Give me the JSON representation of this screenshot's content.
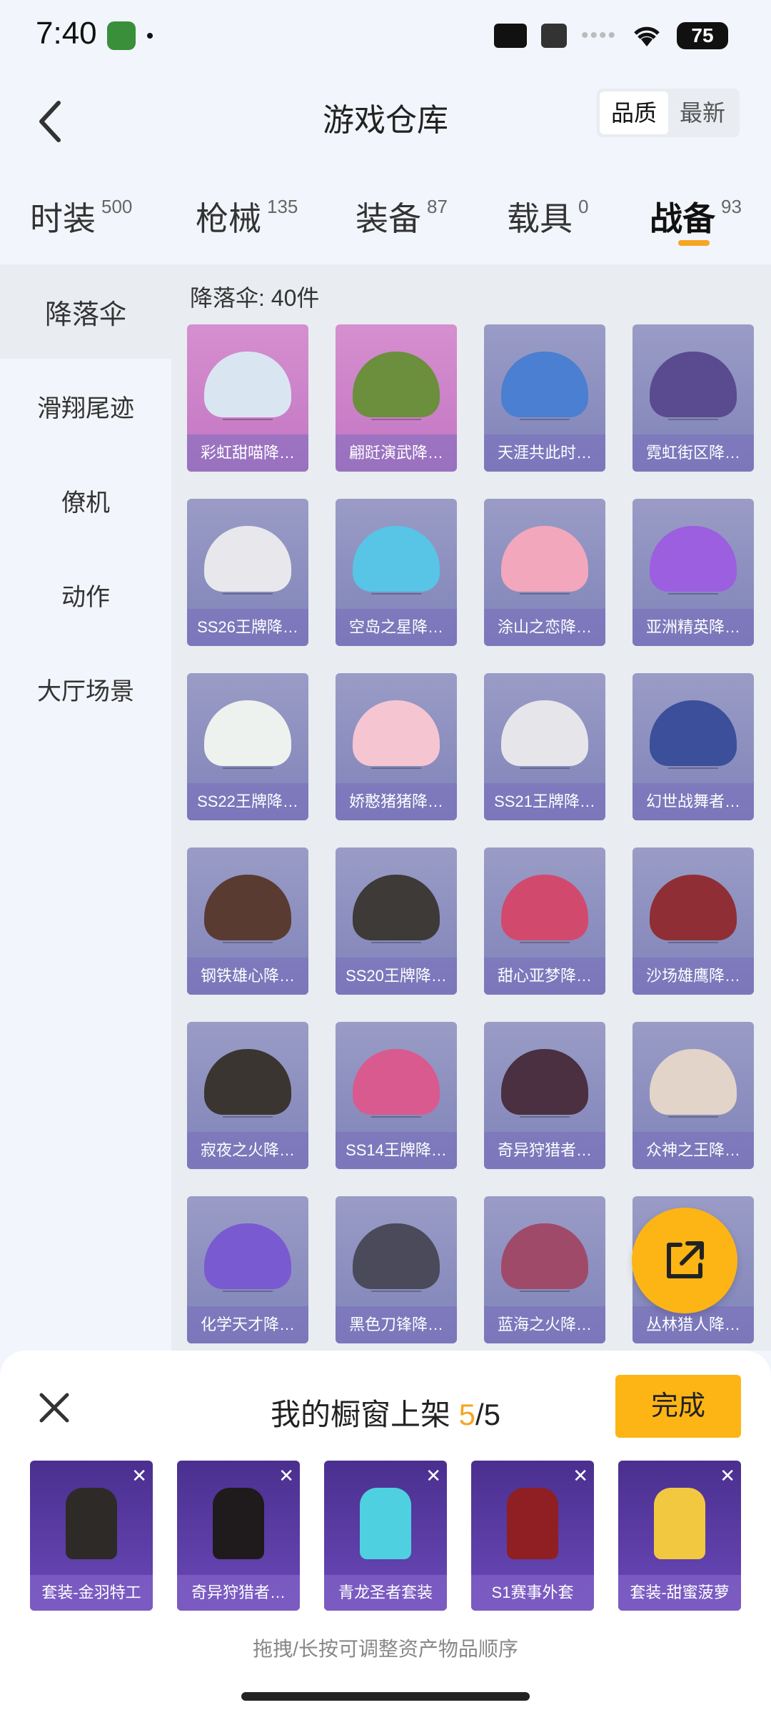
{
  "status_bar": {
    "time": "7:40",
    "battery": "75"
  },
  "header": {
    "title": "游戏仓库",
    "sort_options": [
      "品质",
      "最新"
    ],
    "sort_selected": "品质"
  },
  "tabs": [
    {
      "label": "时装",
      "count": "500"
    },
    {
      "label": "枪械",
      "count": "135"
    },
    {
      "label": "装备",
      "count": "87"
    },
    {
      "label": "载具",
      "count": "0"
    },
    {
      "label": "战备",
      "count": "93"
    }
  ],
  "active_tab": "战备",
  "sidenav": [
    "降落伞",
    "滑翔尾迹",
    "僚机",
    "动作",
    "大厅场景"
  ],
  "active_sidenav": "降落伞",
  "section_title": "降落伞: 40件",
  "items": [
    {
      "label": "彩虹甜喵降…",
      "rarity": "pink",
      "color": "#d9e6f2"
    },
    {
      "label": "翩跹演武降…",
      "rarity": "pink",
      "color": "#6b8f3c"
    },
    {
      "label": "天涯共此时…",
      "rarity": "purple",
      "color": "#4a7fd1"
    },
    {
      "label": "霓虹街区降…",
      "rarity": "purple",
      "color": "#5a4a8f"
    },
    {
      "label": "SS26王牌降…",
      "rarity": "purple",
      "color": "#e8e8ec"
    },
    {
      "label": "空岛之星降…",
      "rarity": "purple",
      "color": "#58c4e6"
    },
    {
      "label": "涂山之恋降…",
      "rarity": "purple",
      "color": "#f2a7bd"
    },
    {
      "label": "亚洲精英降…",
      "rarity": "purple",
      "color": "#9b5fe0"
    },
    {
      "label": "SS22王牌降…",
      "rarity": "purple",
      "color": "#eef2ee"
    },
    {
      "label": "娇憨猪猪降…",
      "rarity": "purple",
      "color": "#f6c5d2"
    },
    {
      "label": "SS21王牌降…",
      "rarity": "purple",
      "color": "#e6e6ea"
    },
    {
      "label": "幻世战舞者…",
      "rarity": "purple",
      "color": "#3b4f9a"
    },
    {
      "label": "钢铁雄心降…",
      "rarity": "purple",
      "color": "#5a3b32"
    },
    {
      "label": "SS20王牌降…",
      "rarity": "purple",
      "color": "#3d3a38"
    },
    {
      "label": "甜心亚梦降…",
      "rarity": "purple",
      "color": "#d14a6e"
    },
    {
      "label": "沙场雄鹰降…",
      "rarity": "purple",
      "color": "#8f2f35"
    },
    {
      "label": "寂夜之火降…",
      "rarity": "purple",
      "color": "#3a3530"
    },
    {
      "label": "SS14王牌降…",
      "rarity": "purple",
      "color": "#d95a8f"
    },
    {
      "label": "奇异狩猎者…",
      "rarity": "purple",
      "color": "#4a3040"
    },
    {
      "label": "众神之王降…",
      "rarity": "purple",
      "color": "#e2d4c8"
    },
    {
      "label": "化学天才降…",
      "rarity": "purple",
      "color": "#7a5ad0"
    },
    {
      "label": "黑色刀锋降…",
      "rarity": "purple",
      "color": "#4a4a5a"
    },
    {
      "label": "蓝海之火降…",
      "rarity": "purple",
      "color": "#a04a6a"
    },
    {
      "label": "丛林猎人降…",
      "rarity": "purple",
      "color": "#8a8aa8"
    }
  ],
  "showcase": {
    "title": "我的橱窗上架",
    "current": "5",
    "separator": "/",
    "total": "5",
    "done_label": "完成",
    "slots": [
      {
        "label": "套装-金羽特工",
        "color": "#2e2a28"
      },
      {
        "label": "奇异狩猎者…",
        "color": "#1f1a1c"
      },
      {
        "label": "青龙圣者套装",
        "color": "#4fd0e0"
      },
      {
        "label": "S1赛事外套",
        "color": "#8f1f22"
      },
      {
        "label": "套装-甜蜜菠萝",
        "color": "#f2c840"
      }
    ],
    "hint": "拖拽/长按可调整资产物品顺序"
  }
}
